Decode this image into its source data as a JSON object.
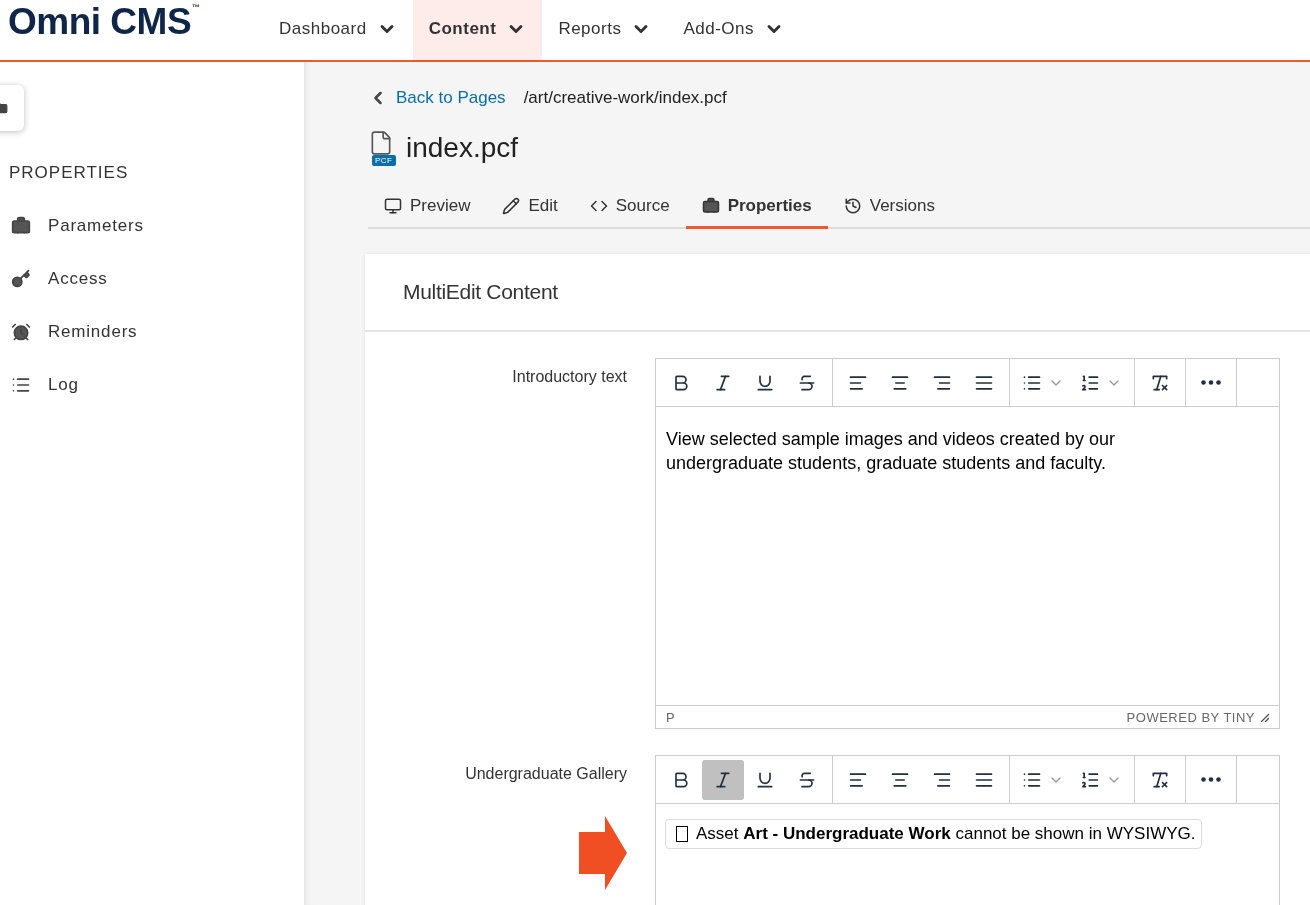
{
  "header": {
    "logo": "Omni CMS",
    "logo_mark": "™",
    "nav": [
      {
        "label": "Dashboard",
        "selected": false
      },
      {
        "label": "Content",
        "selected": true
      },
      {
        "label": "Reports",
        "selected": false
      },
      {
        "label": "Add-Ons",
        "selected": false
      }
    ]
  },
  "sidebar": {
    "title": "PROPERTIES",
    "items": [
      {
        "label": "Parameters",
        "kind": "parameters"
      },
      {
        "label": "Access",
        "kind": "access"
      },
      {
        "label": "Reminders",
        "kind": "reminders"
      },
      {
        "label": "Log",
        "kind": "log"
      }
    ]
  },
  "breadcrumb": {
    "back": "Back to Pages",
    "path": "/art/creative-work/index.pcf"
  },
  "page": {
    "title": "index.pcf",
    "badge": "PCF"
  },
  "tabs": [
    {
      "label": "Preview",
      "kind": "preview",
      "selected": false
    },
    {
      "label": "Edit",
      "kind": "edit",
      "selected": false
    },
    {
      "label": "Source",
      "kind": "source",
      "selected": false
    },
    {
      "label": "Properties",
      "kind": "properties",
      "selected": true
    },
    {
      "label": "Versions",
      "kind": "versions",
      "selected": false
    }
  ],
  "card": {
    "title": "MultiEdit Content",
    "fields": [
      {
        "label": "Introductory text",
        "kind": "text",
        "toolbar": [
          {
            "kind": "bold",
            "active": false
          },
          {
            "kind": "italic",
            "active": false
          },
          {
            "kind": "underline",
            "active": false
          },
          {
            "kind": "strike",
            "active": false
          },
          {
            "kind": "align-left",
            "active": false
          },
          {
            "kind": "align-center",
            "active": false
          },
          {
            "kind": "align-right",
            "active": false
          },
          {
            "kind": "justify",
            "active": false
          },
          {
            "kind": "bullets",
            "active": false
          },
          {
            "kind": "numbers",
            "active": false
          },
          {
            "kind": "clear",
            "active": false
          },
          {
            "kind": "more",
            "active": false
          }
        ],
        "content": "View selected sample images and videos created by our undergraduate students, graduate students and faculty.",
        "status_path": "P",
        "status_brand": "POWERED BY TINY"
      },
      {
        "label": "Undergraduate Gallery",
        "kind": "asset",
        "toolbar": [
          {
            "kind": "bold",
            "active": false
          },
          {
            "kind": "italic",
            "active": true
          },
          {
            "kind": "underline",
            "active": false
          },
          {
            "kind": "strike",
            "active": false
          },
          {
            "kind": "align-left",
            "active": false
          },
          {
            "kind": "align-center",
            "active": false
          },
          {
            "kind": "align-right",
            "active": false
          },
          {
            "kind": "justify",
            "active": false
          },
          {
            "kind": "bullets",
            "active": false
          },
          {
            "kind": "numbers",
            "active": false
          },
          {
            "kind": "clear",
            "active": false
          },
          {
            "kind": "more",
            "active": false
          }
        ],
        "content": "Asset **Art - Undergraduate Work** cannot be shown in WYSIWYG."
      }
    ]
  }
}
